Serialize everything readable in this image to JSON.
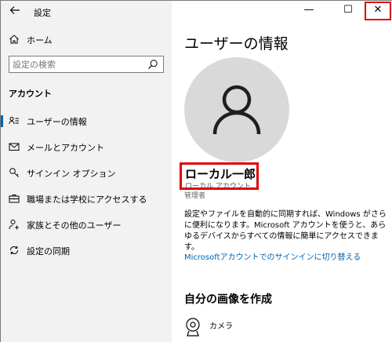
{
  "window": {
    "app_title": "設定",
    "controls": {
      "minimize": "—",
      "maximize": "☐",
      "close": "✕"
    }
  },
  "sidebar": {
    "home_label": "ホーム",
    "search_placeholder": "設定の検索",
    "section_heading": "アカウント",
    "items": [
      {
        "label": "ユーザーの情報",
        "icon": "user-card-icon",
        "active": true
      },
      {
        "label": "メールとアカウント",
        "icon": "mail-icon",
        "active": false
      },
      {
        "label": "サインイン オプション",
        "icon": "key-icon",
        "active": false
      },
      {
        "label": "職場または学校にアクセスする",
        "icon": "briefcase-icon",
        "active": false
      },
      {
        "label": "家族とその他のユーザー",
        "icon": "add-person-icon",
        "active": false
      },
      {
        "label": "設定の同期",
        "icon": "sync-icon",
        "active": false
      }
    ]
  },
  "main": {
    "page_title": "ユーザーの情報",
    "user_name": "ローカル一郎",
    "account_type": "ローカル アカウント",
    "user_role": "管理者",
    "description": "設定やファイルを自動的に同期すれば、Windows がさらに便利になります。Microsoft アカウントを使うと、あらゆるデバイスからすべての情報に簡単にアクセスできます。",
    "signin_link": "Microsoftアカウントでのサインインに切り替える",
    "create_picture_heading": "自分の画像を作成",
    "camera_label": "カメラ"
  },
  "colors": {
    "accent": "#0063b1",
    "highlight_red": "#e00000",
    "sidebar_bg": "#f2f2f2",
    "avatar_bg": "#d9d9d9"
  }
}
